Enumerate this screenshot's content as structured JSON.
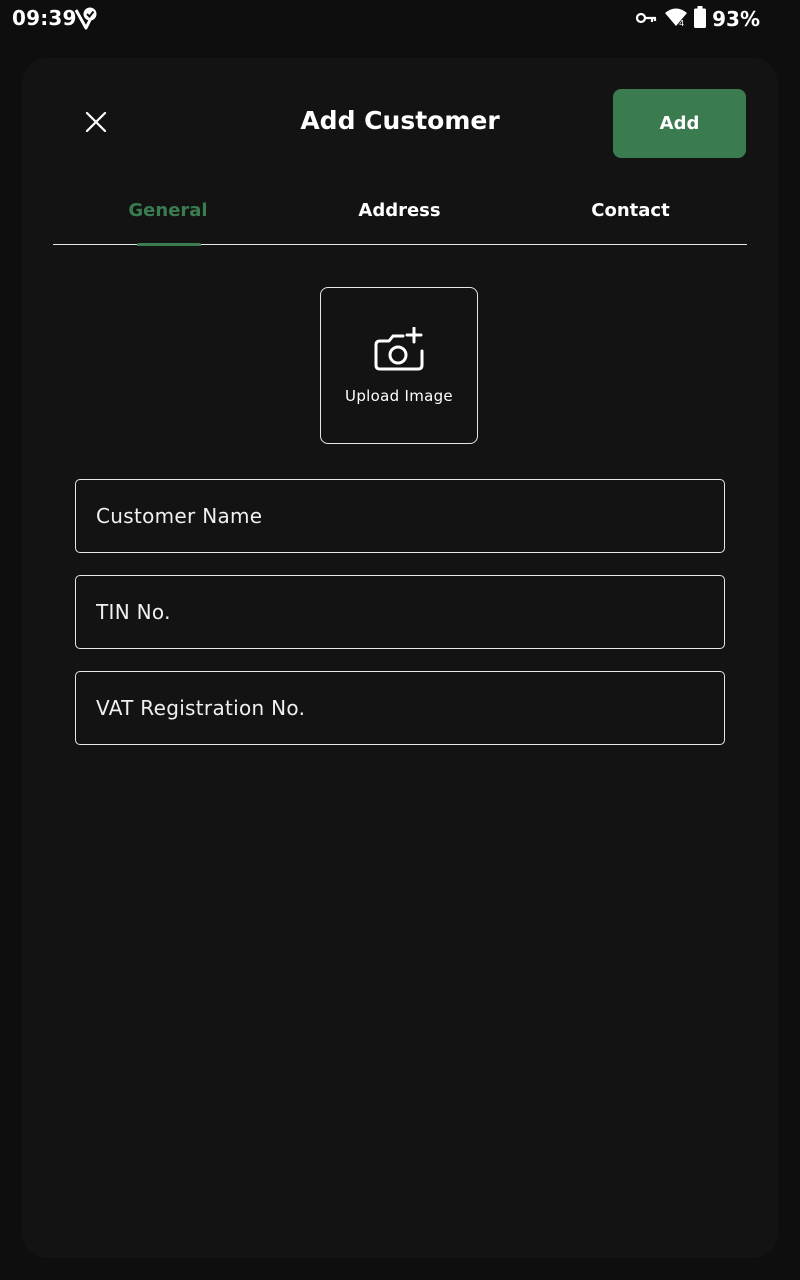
{
  "status_bar": {
    "time": "09:39",
    "battery": "93%",
    "icons": [
      "app-notification-icon",
      "vpn-key-icon",
      "wifi-icon",
      "battery-icon"
    ]
  },
  "header": {
    "title": "Add Customer",
    "add_label": "Add",
    "close_icon": "close-icon"
  },
  "tabs": [
    {
      "label": "General",
      "active": true
    },
    {
      "label": "Address",
      "active": false
    },
    {
      "label": "Contact",
      "active": false
    }
  ],
  "upload": {
    "label": "Upload Image",
    "icon": "camera-add-icon"
  },
  "form": {
    "customer_name": {
      "placeholder": "Customer Name",
      "value": ""
    },
    "tin": {
      "placeholder": "TIN No.",
      "value": ""
    },
    "vat": {
      "placeholder": "VAT Registration No.",
      "value": ""
    }
  },
  "colors": {
    "accent": "#3a7c4f",
    "background": "#0e0e0e",
    "sheet": "#131313",
    "border": "#e6e6e6"
  }
}
